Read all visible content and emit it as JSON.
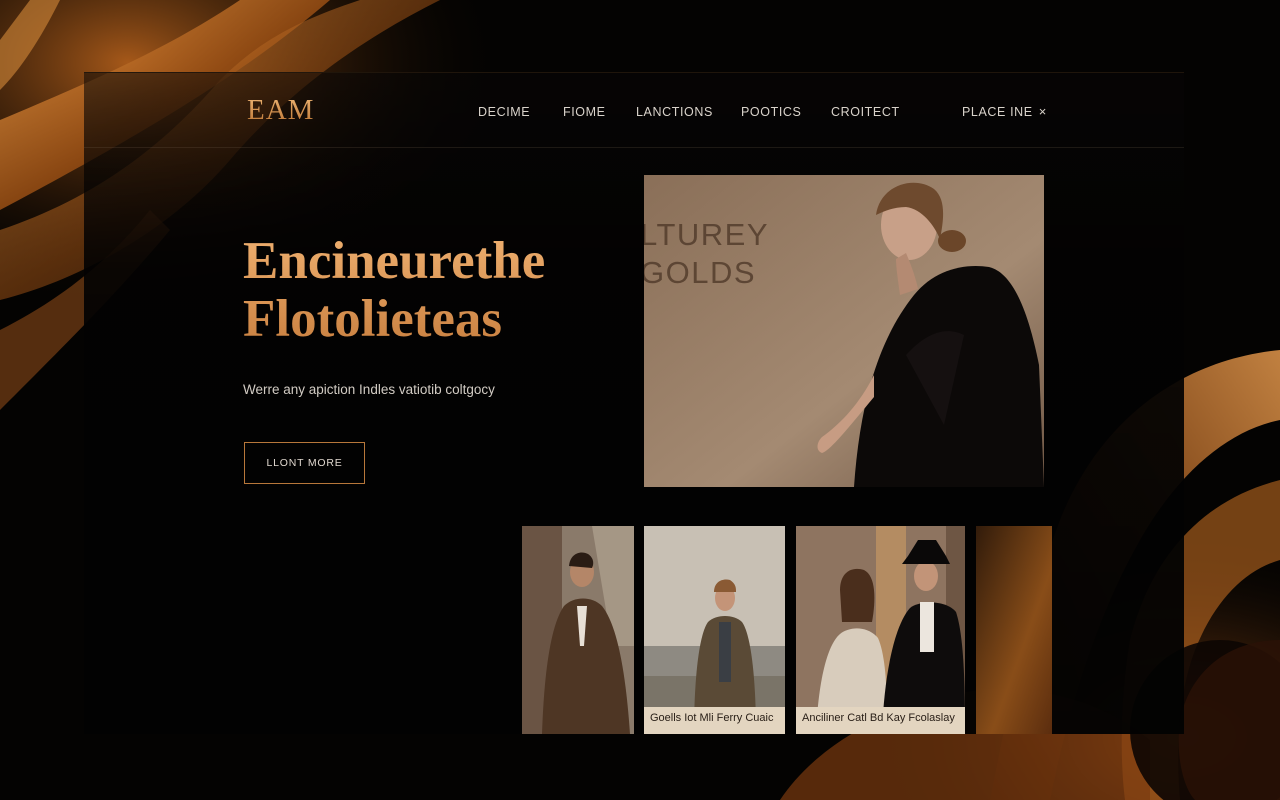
{
  "brand": {
    "logo": "EAM"
  },
  "nav": {
    "items": [
      "DECIME",
      "FIOME",
      "LANCTIONS",
      "POOTICS",
      "CROITECT"
    ],
    "place": {
      "label": "PLACE INE",
      "icon": "close-icon"
    }
  },
  "hero": {
    "title_line1": "Encineurethe",
    "title_line2": "Flotolieteas",
    "subtitle": "Werre any apiction Indles vatiotib coltgocy",
    "cta": "LLONT MORE"
  },
  "featured": {
    "wall_text_line1": "LTUREY",
    "wall_text_line2": "GOLDS"
  },
  "gallery": [
    {
      "caption": ""
    },
    {
      "caption": "Goells Iot Mli Ferry Cuaic"
    },
    {
      "caption": "Anciliner Catl Bd Kay Fcolaslay"
    },
    {
      "caption": ""
    }
  ],
  "colors": {
    "accent": "#d99a5c",
    "background": "#040302",
    "caption_bg": "#e3d5c0"
  }
}
